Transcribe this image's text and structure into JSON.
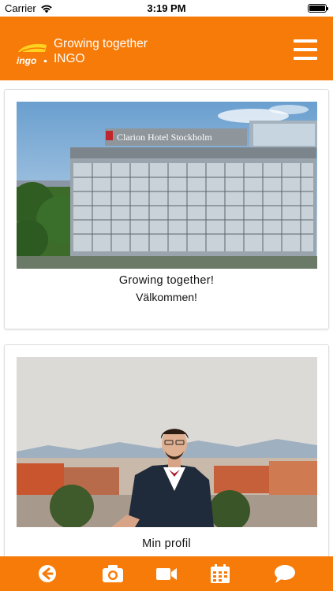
{
  "status_bar": {
    "carrier": "Carrier",
    "time": "3:19 PM",
    "battery_level": 1.0
  },
  "header": {
    "logo_text": "ingo",
    "title": "Growing together",
    "subtitle": "INGO",
    "menu_icon": "hamburger-menu-icon",
    "brand_color": "#f77b08"
  },
  "cards": [
    {
      "title": "Growing together!",
      "subtitle": "Välkommen!",
      "image_sign": "Clarion Hotel Stockholm"
    },
    {
      "title": "Min profil"
    }
  ],
  "bottom_nav": [
    {
      "icon": "back-arrow-icon"
    },
    {
      "icon": "camera-icon"
    },
    {
      "icon": "video-camera-icon"
    },
    {
      "icon": "calendar-icon"
    },
    {
      "icon": "chat-bubble-icon"
    }
  ]
}
